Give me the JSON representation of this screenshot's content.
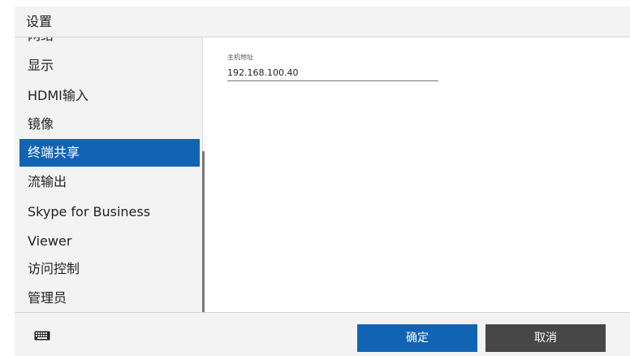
{
  "header": {
    "title": "设置"
  },
  "sidebar": {
    "items": [
      {
        "label": "网络",
        "selected": false
      },
      {
        "label": "显示",
        "selected": false
      },
      {
        "label": "HDMI输入",
        "selected": false
      },
      {
        "label": "镜像",
        "selected": false
      },
      {
        "label": "终端共享",
        "selected": true
      },
      {
        "label": "流输出",
        "selected": false
      },
      {
        "label": "Skype for Business",
        "selected": false
      },
      {
        "label": "Viewer",
        "selected": false
      },
      {
        "label": "访问控制",
        "selected": false
      },
      {
        "label": "管理员",
        "selected": false
      }
    ]
  },
  "content": {
    "host": {
      "label": "主机地址",
      "value": "192.168.100.40"
    }
  },
  "footer": {
    "keyboard_icon": "keyboard-icon",
    "ok_label": "确定",
    "cancel_label": "取消"
  },
  "colors": {
    "accent": "#1164b4",
    "cancel": "#474747",
    "panel": "#f3f3f3"
  }
}
